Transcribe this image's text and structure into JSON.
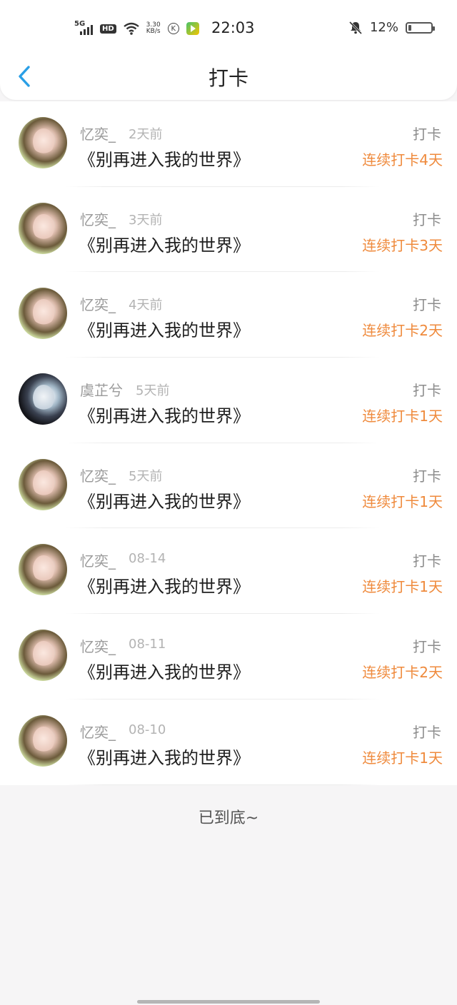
{
  "status_bar": {
    "network": "5G",
    "hd": "HD",
    "speed_value": "3.30",
    "speed_unit": "KB/s",
    "k_label": "K",
    "time": "22:03",
    "battery_pct": "12%",
    "battery_level": 0.12
  },
  "header": {
    "title": "打卡",
    "back_icon": "chevron-left-icon"
  },
  "records": [
    {
      "name": "忆奕_",
      "time": "2天前",
      "book": "《别再进入我的世界》",
      "kind": "打卡",
      "streak": "连续打卡4天",
      "avatar": "avatar-girl-flower"
    },
    {
      "name": "忆奕_",
      "time": "3天前",
      "book": "《别再进入我的世界》",
      "kind": "打卡",
      "streak": "连续打卡3天",
      "avatar": "avatar-girl-flower"
    },
    {
      "name": "忆奕_",
      "time": "4天前",
      "book": "《别再进入我的世界》",
      "kind": "打卡",
      "streak": "连续打卡2天",
      "avatar": "avatar-girl-flower"
    },
    {
      "name": "虞芷兮",
      "time": "5天前",
      "book": "《别再进入我的世界》",
      "kind": "打卡",
      "streak": "连续打卡1天",
      "avatar": "avatar-dark-hair"
    },
    {
      "name": "忆奕_",
      "time": "5天前",
      "book": "《别再进入我的世界》",
      "kind": "打卡",
      "streak": "连续打卡1天",
      "avatar": "avatar-girl-flower"
    },
    {
      "name": "忆奕_",
      "time": "08-14",
      "book": "《别再进入我的世界》",
      "kind": "打卡",
      "streak": "连续打卡1天",
      "avatar": "avatar-girl-flower"
    },
    {
      "name": "忆奕_",
      "time": "08-11",
      "book": "《别再进入我的世界》",
      "kind": "打卡",
      "streak": "连续打卡2天",
      "avatar": "avatar-girl-flower"
    },
    {
      "name": "忆奕_",
      "time": "08-10",
      "book": "《别再进入我的世界》",
      "kind": "打卡",
      "streak": "连续打卡1天",
      "avatar": "avatar-girl-flower"
    }
  ],
  "footer": {
    "end_text": "已到底~"
  },
  "colors": {
    "accent_blue": "#2a9fe6",
    "streak_orange": "#ef8a3c"
  }
}
